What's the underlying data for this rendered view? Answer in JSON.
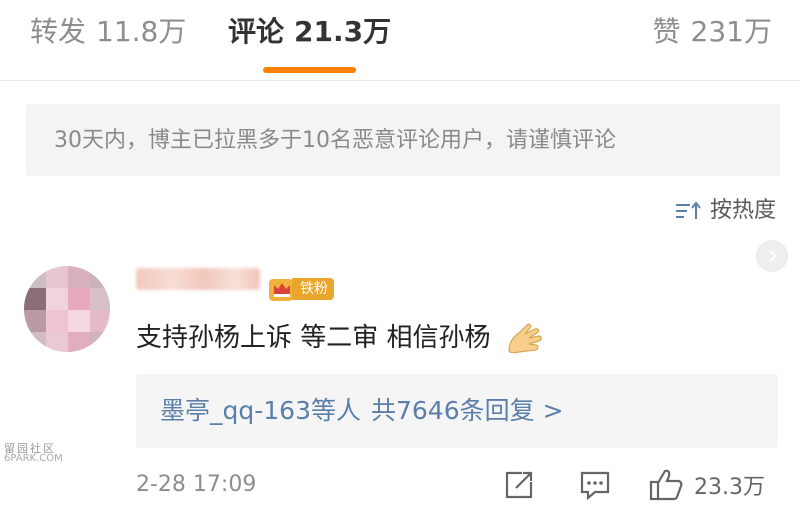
{
  "tabs": {
    "repost": {
      "label": "转发",
      "count": "11.8万"
    },
    "comment": {
      "label": "评论",
      "count": "21.3万"
    },
    "like": {
      "label": "赞",
      "count": "231万"
    },
    "active": "comment"
  },
  "notice": {
    "text": "30天内，博主已拉黑多于10名恶意评论用户，请谨慎评论"
  },
  "sort": {
    "label": "按热度",
    "icon": "sort-icon"
  },
  "comment": {
    "badge": "铁粉",
    "text": "支持孙杨上诉 等二审 相信孙杨",
    "emoji": "hand-icon",
    "reply": {
      "users": "墨亭_qq-163",
      "suffix": "等人",
      "total": "共7646条回复",
      "arrow": ">"
    },
    "time": "2-28 17:09",
    "like_count": "23.3万"
  },
  "watermark": {
    "top": "留园社区",
    "bottom": "6PARK.COM"
  },
  "colors": {
    "accent": "#ff8200",
    "link": "#5b7fa8",
    "badge": "#e9a52c"
  }
}
